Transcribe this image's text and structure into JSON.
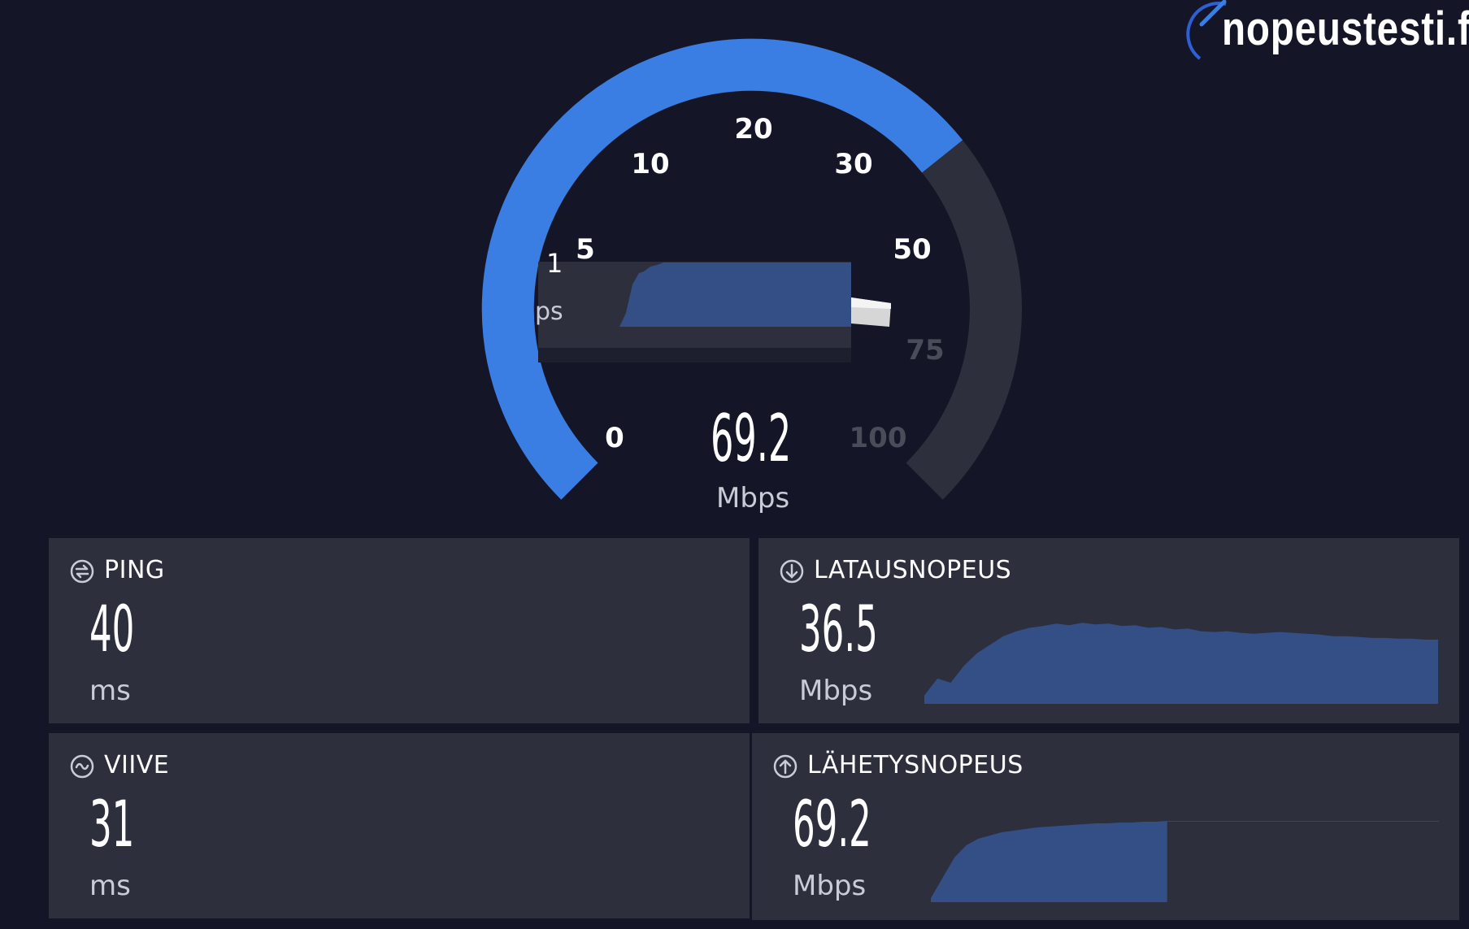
{
  "brand": {
    "name": "nopeustesti.fi"
  },
  "gauge": {
    "value": "69.2",
    "unit": "Mbps",
    "scale_labels": [
      "0",
      "5",
      "10",
      "20",
      "30",
      "50",
      "75",
      "100"
    ],
    "fill_fraction": 0.69,
    "colors": {
      "active": "#3a7ee3",
      "inactive": "#2e2f3d",
      "background": "#141627"
    },
    "overlay": {
      "partial_value": "1",
      "partial_unit": "ps"
    }
  },
  "cards": {
    "ping": {
      "label": "PING",
      "value": "40",
      "unit": "ms",
      "icon": "ping-icon"
    },
    "viive": {
      "label": "VIIVE",
      "value": "31",
      "unit": "ms",
      "icon": "jitter-icon"
    },
    "download": {
      "label": "LATAUSNOPEUS",
      "value": "36.5",
      "unit": "Mbps",
      "icon": "download-icon",
      "graph": [
        0.1,
        0.3,
        0.25,
        0.45,
        0.6,
        0.7,
        0.8,
        0.86,
        0.9,
        0.92,
        0.95,
        0.93,
        0.96,
        0.94,
        0.95,
        0.92,
        0.93,
        0.9,
        0.91,
        0.88,
        0.89,
        0.86,
        0.85,
        0.86,
        0.84,
        0.83,
        0.84,
        0.85,
        0.84,
        0.83,
        0.82,
        0.8,
        0.8,
        0.79,
        0.78,
        0.78,
        0.77,
        0.77,
        0.76,
        0.76
      ]
    },
    "upload": {
      "label": "LÄHETYSNOPEUS",
      "value": "69.2",
      "unit": "Mbps",
      "icon": "upload-icon",
      "graph": [
        0.05,
        0.3,
        0.55,
        0.7,
        0.78,
        0.82,
        0.86,
        0.88,
        0.9,
        0.92,
        0.93,
        0.94,
        0.95,
        0.96,
        0.97,
        0.97,
        0.98,
        0.98,
        0.99,
        0.99,
        1.0
      ]
    }
  }
}
